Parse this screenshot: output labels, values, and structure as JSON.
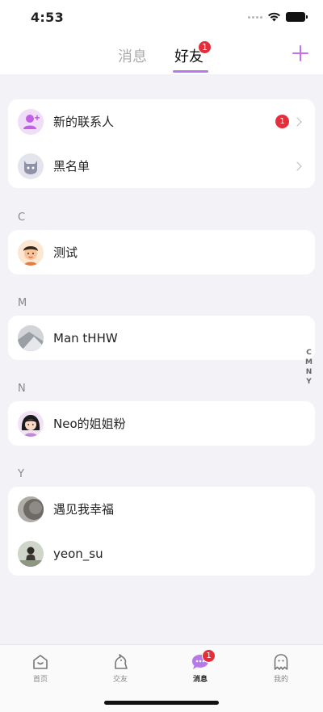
{
  "status_bar": {
    "time": "4:53"
  },
  "top_nav": {
    "tab_messages": "消息",
    "tab_friends": "好友",
    "friends_badge": "1"
  },
  "top_card": {
    "new_contacts": {
      "label": "新的联系人",
      "badge": "1"
    },
    "blacklist": {
      "label": "黑名单"
    }
  },
  "sections": {
    "c": {
      "letter": "C",
      "contacts": [
        {
          "name": "测试"
        }
      ]
    },
    "m": {
      "letter": "M",
      "contacts": [
        {
          "name": "Man tHHW"
        }
      ]
    },
    "n": {
      "letter": "N",
      "contacts": [
        {
          "name": "Neo的姐姐粉"
        }
      ]
    },
    "y": {
      "letter": "Y",
      "contacts": [
        {
          "name": "遇见我幸福"
        },
        {
          "name": "yeon_su"
        }
      ]
    }
  },
  "alpha_index": [
    "C",
    "M",
    "N",
    "Y"
  ],
  "bottom_nav": {
    "home": "首页",
    "social": "交友",
    "messages": "消息",
    "messages_badge": "1",
    "profile": "我的"
  },
  "colors": {
    "accent": "#b57ae8",
    "badge": "#e62e3a",
    "background": "#f3f3f7"
  },
  "icons": [
    "wifi-icon",
    "battery-icon",
    "add-icon",
    "new-contact-icon",
    "blacklist-icon",
    "chevron-right-icon",
    "home-icon",
    "social-icon",
    "chat-icon",
    "profile-icon"
  ]
}
